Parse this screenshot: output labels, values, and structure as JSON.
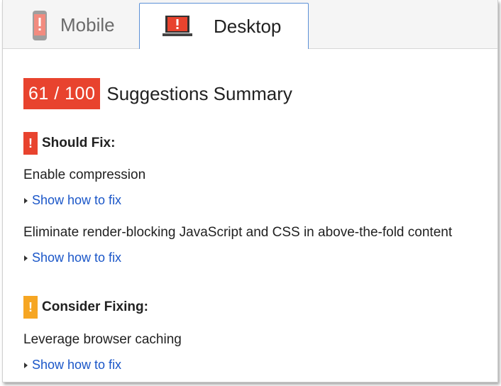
{
  "tabs": [
    {
      "label": "Mobile",
      "icon": "mobile-phone-warning-icon",
      "selected": false
    },
    {
      "label": "Desktop",
      "icon": "laptop-warning-icon",
      "selected": true
    }
  ],
  "summary": {
    "score": "61 / 100",
    "title": "Suggestions Summary",
    "score_color": "#e8432e"
  },
  "should_fix": {
    "badge": "!",
    "title": "Should Fix:",
    "color": "#e8432e",
    "rules": [
      {
        "title": "Enable compression",
        "link": "Show how to fix"
      },
      {
        "title": "Eliminate render-blocking JavaScript and CSS in above-the-fold content",
        "link": "Show how to fix"
      }
    ]
  },
  "consider_fixing": {
    "badge": "!",
    "title": "Consider Fixing:",
    "color": "#f6a623",
    "rules": [
      {
        "title": "Leverage browser caching",
        "link": "Show how to fix"
      }
    ]
  },
  "colors": {
    "link": "#1a56c8",
    "selected_tab_border": "#5c90d6"
  }
}
